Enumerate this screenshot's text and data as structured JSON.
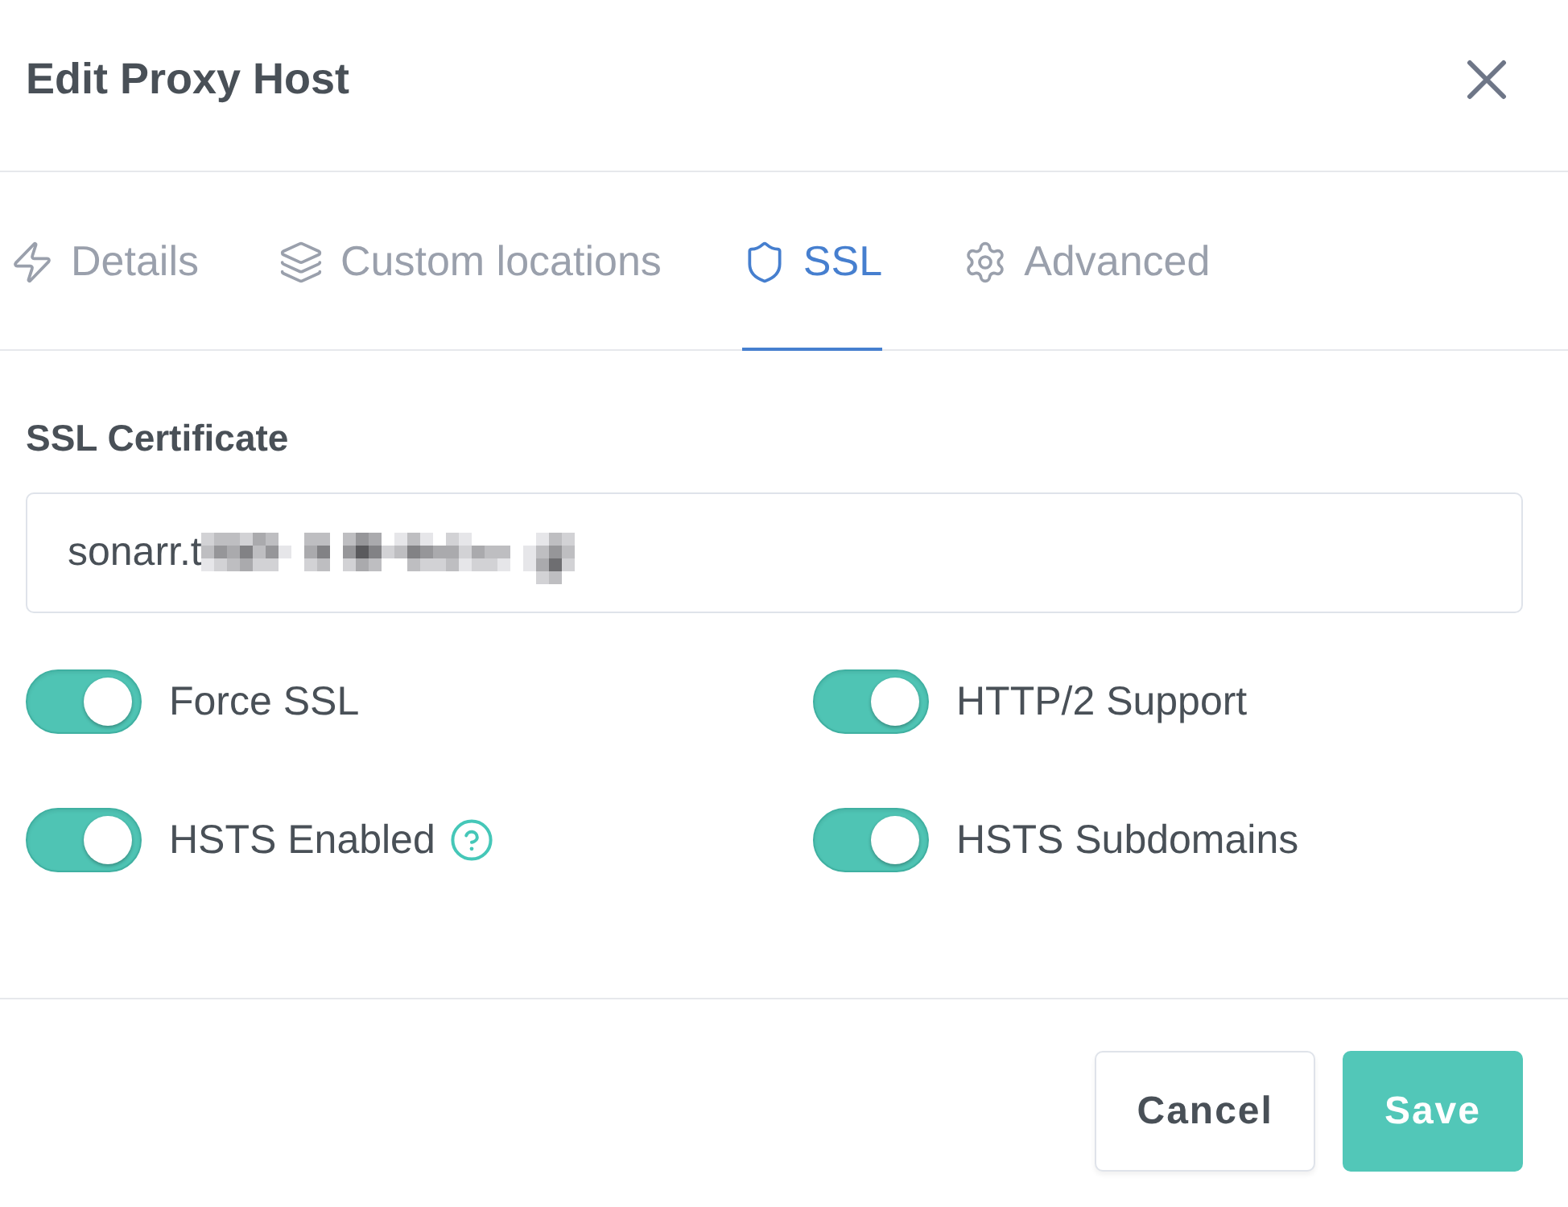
{
  "dialog": {
    "title": "Edit Proxy Host"
  },
  "tabs": [
    {
      "label": "Details",
      "selected": false
    },
    {
      "label": "Custom locations",
      "selected": false
    },
    {
      "label": "SSL",
      "selected": true
    },
    {
      "label": "Advanced",
      "selected": false
    }
  ],
  "ssl_certificate": {
    "label": "SSL Certificate",
    "value": "sonarr.t",
    "redacted": true
  },
  "switches": [
    {
      "label": "Force SSL",
      "on": true,
      "help": false
    },
    {
      "label": "HTTP/2 Support",
      "on": true,
      "help": false
    },
    {
      "label": "HSTS Enabled",
      "on": true,
      "help": true
    },
    {
      "label": "HSTS Subdomains",
      "on": true,
      "help": false
    }
  ],
  "buttons": [
    {
      "label": "Cancel",
      "kind": "secondary"
    },
    {
      "label": "Save",
      "kind": "primary"
    }
  ]
}
